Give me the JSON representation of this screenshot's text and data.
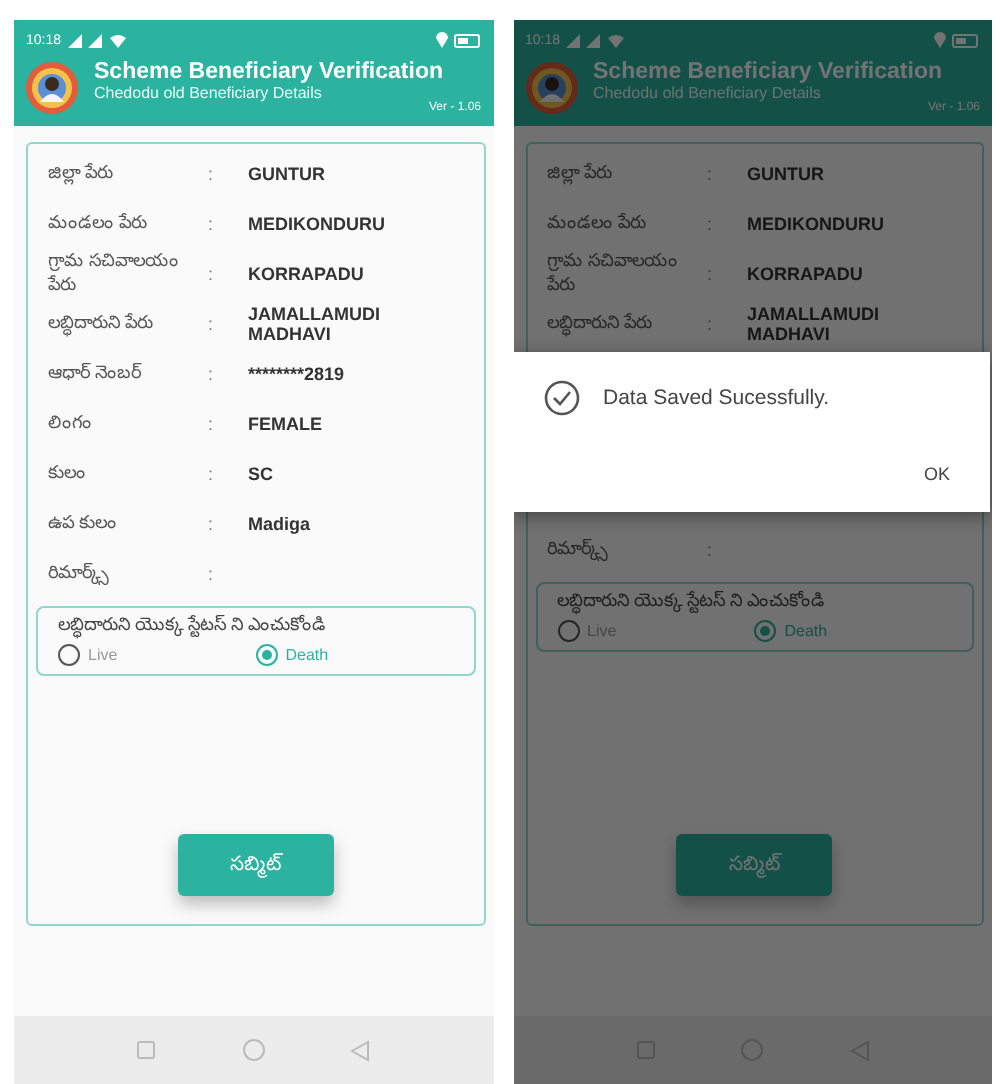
{
  "separator": ":",
  "screens": [
    {
      "status_time": "10:18",
      "title": "Scheme Beneficiary Verification",
      "subtitle": "Chedodu old Beneficiary Details",
      "version": "Ver - 1.06",
      "dimmed": false,
      "items": [
        {
          "kind": "row",
          "label": "జిల్లా పేరు",
          "value": "GUNTUR"
        },
        {
          "kind": "row",
          "label": "మండలం పేరు",
          "value": "MEDIKONDURU"
        },
        {
          "kind": "row",
          "label": "గ్రామ సచివాలయం పేరు",
          "value": "KORRAPADU"
        },
        {
          "kind": "row",
          "label": "లబ్ధిదారుని పేరు",
          "value": "JAMALLAMUDI MADHAVI"
        },
        {
          "kind": "row",
          "label": "ఆధార్ నెంబర్",
          "value": "********2819"
        },
        {
          "kind": "row",
          "label": "లింగం",
          "value": "FEMALE"
        },
        {
          "kind": "row",
          "label": "కులం",
          "value": "SC"
        },
        {
          "kind": "row",
          "label": "ఉప కులం",
          "value": "Madiga"
        },
        {
          "kind": "row",
          "label": "రిమార్క్స్",
          "value": ""
        }
      ],
      "status_question": "లబ్ధిదారుని యొక్క స్టేటస్ ని ఎంచుకోండి",
      "options": [
        {
          "label": "Live",
          "selected": false
        },
        {
          "label": "Death",
          "selected": true
        }
      ],
      "submit": "సబ్మిట్"
    },
    {
      "status_time": "10:18",
      "title": "Scheme Beneficiary Verification",
      "subtitle": "Chedodu old Beneficiary Details",
      "version": "Ver - 1.06",
      "dimmed": true,
      "items": [
        {
          "kind": "row",
          "label": "జిల్లా పేరు",
          "value": "GUNTUR"
        },
        {
          "kind": "row",
          "label": "మండలం పేరు",
          "value": "MEDIKONDURU"
        },
        {
          "kind": "row",
          "label": "గ్రామ సచివాలయం పేరు",
          "value": "KORRAPADU"
        },
        {
          "kind": "row",
          "label": "లబ్ధిదారుని పేరు",
          "value": "JAMALLAMUDI MADHAVI"
        },
        {
          "kind": "dialog",
          "message": "Data Saved Sucessfully.",
          "button": "OK"
        },
        {
          "kind": "row",
          "label": "రిమార్క్స్",
          "value": ""
        }
      ],
      "status_question": "లబ్ధిదారుని యొక్క స్టేటస్ ని ఎంచుకోండి",
      "options": [
        {
          "label": "Live",
          "selected": false
        },
        {
          "label": "Death",
          "selected": true
        }
      ],
      "submit": "సబ్మిట్"
    }
  ]
}
